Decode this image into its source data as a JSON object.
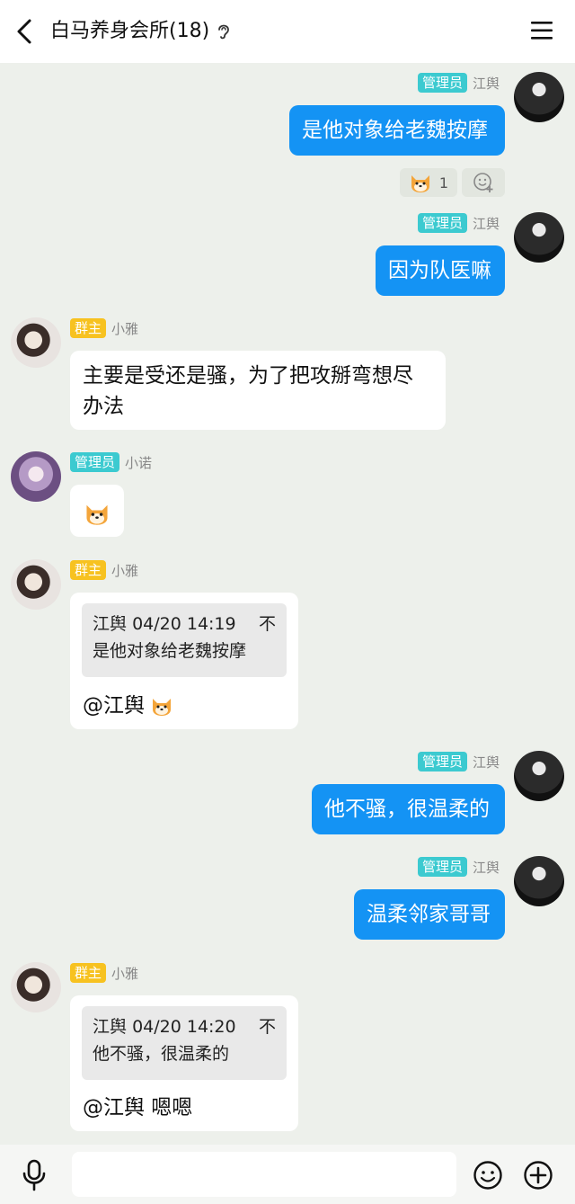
{
  "header": {
    "title": "白马养身会所(18)"
  },
  "messages": [
    {
      "sender": "江舆",
      "role": "管理员",
      "text": "是他对象给老魏按摩"
    },
    {
      "reaction_count": "1"
    },
    {
      "sender": "江舆",
      "role": "管理员",
      "text": "因为队医嘛"
    },
    {
      "sender": "小雅",
      "role": "群主",
      "text": "主要是受还是骚，为了把攻掰弯想尽办法"
    },
    {
      "sender": "小诺",
      "role": "管理员"
    },
    {
      "sender": "小雅",
      "role": "群主",
      "quote": {
        "author": "江舆",
        "time": "04/20 14:19",
        "flag": "不",
        "text": "是他对象给老魏按摩"
      },
      "text": "@江舆"
    },
    {
      "sender": "江舆",
      "role": "管理员",
      "text": "他不骚，很温柔的"
    },
    {
      "sender": "江舆",
      "role": "管理员",
      "text": "温柔邻家哥哥"
    },
    {
      "sender": "小雅",
      "role": "群主",
      "quote": {
        "author": "江舆",
        "time": "04/20 14:20",
        "flag": "不",
        "text": "他不骚，很温柔的"
      },
      "text": "@江舆 嗯嗯"
    }
  ],
  "bottom": {
    "input_value": ""
  },
  "colors": {
    "outgoing_bubble": "#1493f4",
    "admin_badge": "#3ccad0",
    "owner_badge": "#f7c220",
    "chat_bg": "#edf0eb"
  }
}
